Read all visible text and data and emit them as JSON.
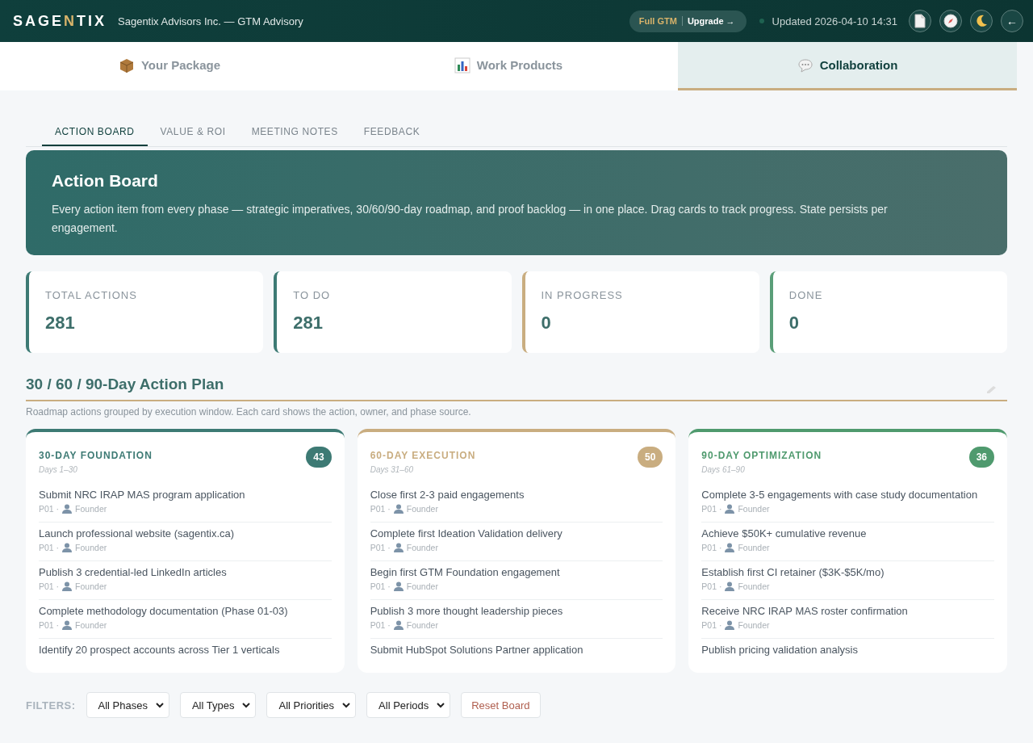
{
  "header": {
    "logo_parts": [
      {
        "text": "SAGE",
        "accent": false
      },
      {
        "text": "N",
        "accent": true
      },
      {
        "text": "TIX",
        "accent": false
      }
    ],
    "subtitle": "Sagentix Advisors Inc. — GTM Advisory",
    "plan": "Full GTM",
    "upgrade": "Upgrade →",
    "updated": "Updated 2026-04-10 14:31",
    "back": "←"
  },
  "main_tabs": [
    {
      "label": "Your Package",
      "kind": "package",
      "selected": false
    },
    {
      "label": "Work Products",
      "kind": "chart",
      "selected": false
    },
    {
      "label": "Collaboration",
      "kind": "chat",
      "selected": true
    }
  ],
  "sub_tabs": [
    {
      "label": "ACTION BOARD",
      "selected": true
    },
    {
      "label": "VALUE & ROI",
      "selected": false
    },
    {
      "label": "MEETING NOTES",
      "selected": false
    },
    {
      "label": "FEEDBACK",
      "selected": false
    }
  ],
  "banner": {
    "title": "Action Board",
    "text": "Every action item from every phase — strategic imperatives, 30/60/90-day roadmap, and proof backlog — in one place. Drag cards to track progress. State persists per engagement."
  },
  "stats": [
    {
      "label": "TOTAL ACTIONS",
      "value": "281",
      "color": "#3d7a74"
    },
    {
      "label": "TO DO",
      "value": "281",
      "color": "#3d7a74"
    },
    {
      "label": "IN PROGRESS",
      "value": "0",
      "color": "#c9ad80"
    },
    {
      "label": "DONE",
      "value": "0",
      "color": "#5a9e78"
    }
  ],
  "plan_section": {
    "title": "30 / 60 / 90-Day Action Plan",
    "subtitle": "Roadmap actions grouped by execution window. Each card shows the action, owner, and phase source."
  },
  "columns": [
    {
      "title": "30-DAY FOUNDATION",
      "days": "Days 1–30",
      "count": "43",
      "color": "#3d7a74",
      "items": [
        {
          "title": "Submit NRC IRAP MAS program application",
          "phase": "P01 ·",
          "owner": "Founder"
        },
        {
          "title": "Launch professional website (sagentix.ca)",
          "phase": "P01 ·",
          "owner": "Founder"
        },
        {
          "title": "Publish 3 credential-led LinkedIn articles",
          "phase": "P01 ·",
          "owner": "Founder"
        },
        {
          "title": "Complete methodology documentation (Phase 01-03)",
          "phase": "P01 ·",
          "owner": "Founder"
        },
        {
          "title": "Identify 20 prospect accounts across Tier 1 verticals"
        }
      ]
    },
    {
      "title": "60-DAY EXECUTION",
      "days": "Days 31–60",
      "count": "50",
      "color": "#c9ad80",
      "items": [
        {
          "title": "Close first 2-3 paid engagements",
          "phase": "P01 ·",
          "owner": "Founder"
        },
        {
          "title": "Complete first Ideation Validation delivery",
          "phase": "P01 ·",
          "owner": "Founder"
        },
        {
          "title": "Begin first GTM Foundation engagement",
          "phase": "P01 ·",
          "owner": "Founder"
        },
        {
          "title": "Publish 3 more thought leadership pieces",
          "phase": "P01 ·",
          "owner": "Founder"
        },
        {
          "title": "Submit HubSpot Solutions Partner application"
        }
      ]
    },
    {
      "title": "90-DAY OPTIMIZATION",
      "days": "Days 61–90",
      "count": "36",
      "color": "#4f9a6e",
      "items": [
        {
          "title": "Complete 3-5 engagements with case study documentation",
          "phase": "P01 ·",
          "owner": "Founder"
        },
        {
          "title": "Achieve $50K+ cumulative revenue",
          "phase": "P01 ·",
          "owner": "Founder"
        },
        {
          "title": "Establish first CI retainer ($3K-$5K/mo)",
          "phase": "P01 ·",
          "owner": "Founder"
        },
        {
          "title": "Receive NRC IRAP MAS roster confirmation",
          "phase": "P01 ·",
          "owner": "Founder"
        },
        {
          "title": "Publish pricing validation analysis"
        }
      ]
    }
  ],
  "filters": {
    "label": "FILTERS:",
    "selects": [
      "All Phases",
      "All Types",
      "All Priorities",
      "All Periods"
    ],
    "reset": "Reset Board"
  }
}
